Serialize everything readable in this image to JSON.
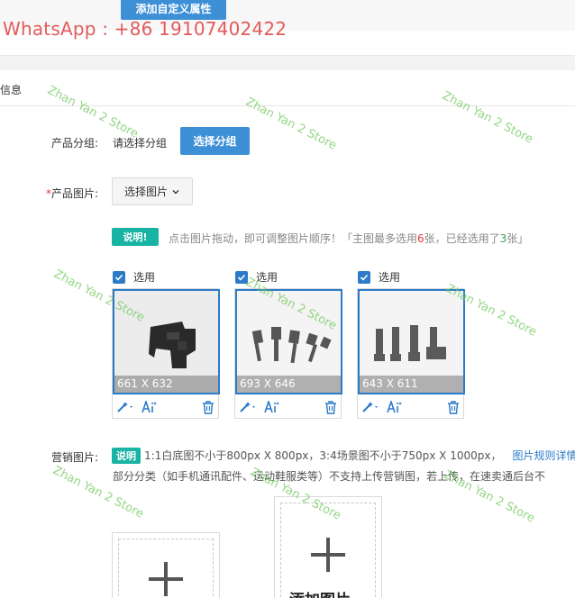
{
  "top": {
    "custom_attr_button": "添加自定义属性",
    "whatsapp": "WhatsApp : +86 19107402422"
  },
  "section": {
    "title": "信息"
  },
  "product_group": {
    "label": "产品分组:",
    "value": "请选择分组",
    "button": "选择分组"
  },
  "product_images": {
    "required_mark": "*",
    "label": "产品图片:",
    "button": "选择图片",
    "note_badge": "说明!",
    "hint_prefix": "点击图片拖动，即可调整图片顺序！「主图最多选用",
    "hint_max": "6",
    "hint_mid": "张，已经选用了",
    "hint_used": "3",
    "hint_suffix": "张」",
    "select_label": "选用",
    "images": [
      {
        "size_text": "661 X 632",
        "selected": true
      },
      {
        "size_text": "693 X 646",
        "selected": true
      },
      {
        "size_text": "643 X 611",
        "selected": true
      }
    ]
  },
  "marketing_images": {
    "label": "营销图片:",
    "note_badge": "说明",
    "line1": "1:1白底图不小于800px X 800px，3:4场景图不小于750px X 1000px，",
    "link": "图片规则详情",
    "line2": "部分分类（如手机通讯配件、运动鞋服类等）不支持上传营销图，若上传，在速卖通后台不",
    "add_image": "添加图片"
  },
  "watermark": "Zhan Yan 2 Store",
  "colors": {
    "primary": "#3d8fd6",
    "teal": "#17b3a3",
    "required": "#e4393c",
    "watermark": "#6ec85a",
    "whatsapp": "#e25b5b"
  },
  "icons": [
    "magic-wand-icon",
    "text-ai-icon",
    "trash-icon",
    "chevron-down-icon",
    "plus-icon",
    "check-icon"
  ]
}
